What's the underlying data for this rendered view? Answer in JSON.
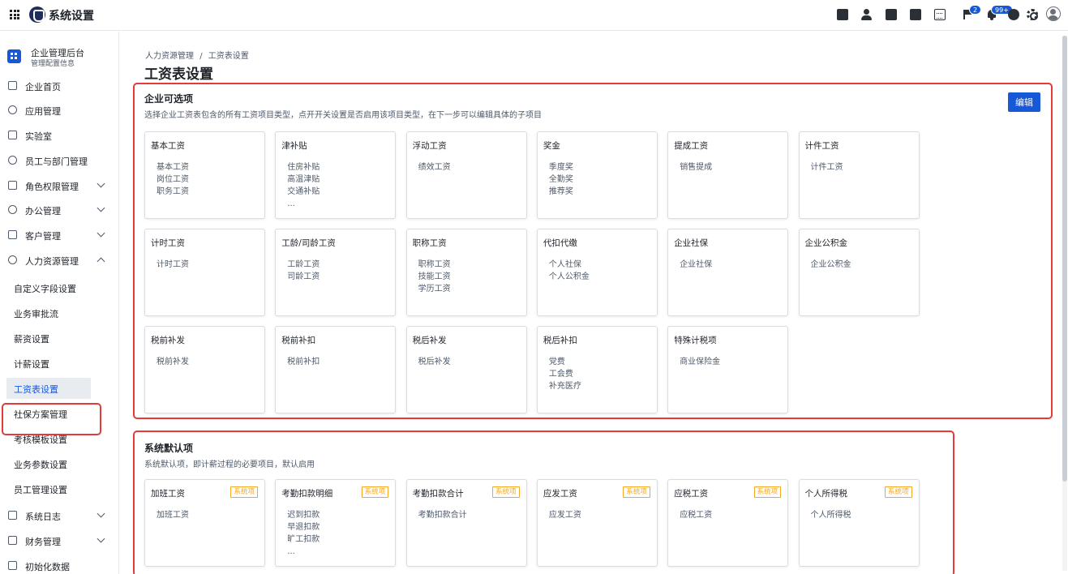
{
  "app": {
    "title": "系统设置"
  },
  "topbar": {
    "notify_badge": "2",
    "bell_badge": "99+"
  },
  "sidebar": {
    "org_name": "企业管理后台",
    "org_sub": "管理配置信息",
    "items": [
      {
        "label": "企业首页",
        "icon": "home-icon",
        "chevron": "none"
      },
      {
        "label": "应用管理",
        "icon": "apps-icon",
        "chevron": "none"
      },
      {
        "label": "实验室",
        "icon": "bulb-icon",
        "chevron": "none"
      },
      {
        "label": "员工与部门管理",
        "icon": "people-icon",
        "chevron": "none"
      },
      {
        "label": "角色权限管理",
        "icon": "role-icon",
        "chevron": "down"
      },
      {
        "label": "办公管理",
        "icon": "office-icon",
        "chevron": "down"
      },
      {
        "label": "客户管理",
        "icon": "customer-icon",
        "chevron": "down"
      },
      {
        "label": "人力资源管理",
        "icon": "hr-icon",
        "chevron": "up"
      }
    ],
    "sub_items": [
      "自定义字段设置",
      "业务审批流",
      "薪资设置",
      "计薪设置",
      "工资表设置",
      "社保方案管理",
      "考核模板设置",
      "业务参数设置",
      "员工管理设置"
    ],
    "active_sub": "工资表设置",
    "bottom_items": [
      {
        "label": "系统日志",
        "icon": "log-icon",
        "chevron": "down"
      },
      {
        "label": "财务管理",
        "icon": "finance-icon",
        "chevron": "down"
      },
      {
        "label": "初始化数据",
        "icon": "init-icon",
        "chevron": "none"
      }
    ]
  },
  "breadcrumb": [
    "人力资源管理",
    "/",
    "工资表设置"
  ],
  "page_title": "工资表设置",
  "optional": {
    "title": "企业可选项",
    "desc": "选择企业工资表包含的所有工资项目类型，点开开关设置是否启用该项目类型，在下一步可以编辑具体的子项目",
    "edit_label": "编辑",
    "cards": [
      {
        "title": "基本工资",
        "items": [
          "基本工资",
          "岗位工资",
          "职务工资"
        ]
      },
      {
        "title": "津补贴",
        "items": [
          "住房补贴",
          "高温津贴",
          "交通补贴",
          "..."
        ]
      },
      {
        "title": "浮动工资",
        "items": [
          "绩效工资"
        ]
      },
      {
        "title": "奖金",
        "items": [
          "季度奖",
          "全勤奖",
          "推荐奖"
        ]
      },
      {
        "title": "提成工资",
        "items": [
          "销售提成"
        ]
      },
      {
        "title": "计件工资",
        "items": [
          "计件工资"
        ]
      },
      {
        "title": "计时工资",
        "items": [
          "计时工资"
        ]
      },
      {
        "title": "工龄/司龄工资",
        "items": [
          "工龄工资",
          "司龄工资"
        ]
      },
      {
        "title": "职称工资",
        "items": [
          "职称工资",
          "技能工资",
          "学历工资"
        ]
      },
      {
        "title": "代扣代缴",
        "items": [
          "个人社保",
          "个人公积金"
        ]
      },
      {
        "title": "企业社保",
        "items": [
          "企业社保"
        ]
      },
      {
        "title": "企业公积金",
        "items": [
          "企业公积金"
        ]
      },
      {
        "title": "税前补发",
        "items": [
          "税前补发"
        ]
      },
      {
        "title": "税前补扣",
        "items": [
          "税前补扣"
        ]
      },
      {
        "title": "税后补发",
        "items": [
          "税后补发"
        ]
      },
      {
        "title": "税后补扣",
        "items": [
          "党费",
          "工会费",
          "补充医疗"
        ]
      },
      {
        "title": "特殊计税项",
        "items": [
          "商业保险金"
        ]
      }
    ]
  },
  "default": {
    "title": "系统默认项",
    "desc": "系统默认项，即计薪过程的必要项目，默认启用",
    "tag": "系统项",
    "cards": [
      {
        "title": "加班工资",
        "items": [
          "加班工资"
        ]
      },
      {
        "title": "考勤扣款明细",
        "items": [
          "迟到扣款",
          "早退扣款",
          "旷工扣款",
          "..."
        ]
      },
      {
        "title": "考勤扣款合计",
        "items": [
          "考勤扣款合计"
        ]
      },
      {
        "title": "应发工资",
        "items": [
          "应发工资"
        ]
      },
      {
        "title": "应税工资",
        "items": [
          "应税工资"
        ]
      },
      {
        "title": "个人所得税",
        "items": [
          "个人所得税"
        ]
      }
    ]
  },
  "colors": {
    "accent": "#1658d8",
    "highlight_border": "#e5393a",
    "tag": "#f5a623"
  }
}
